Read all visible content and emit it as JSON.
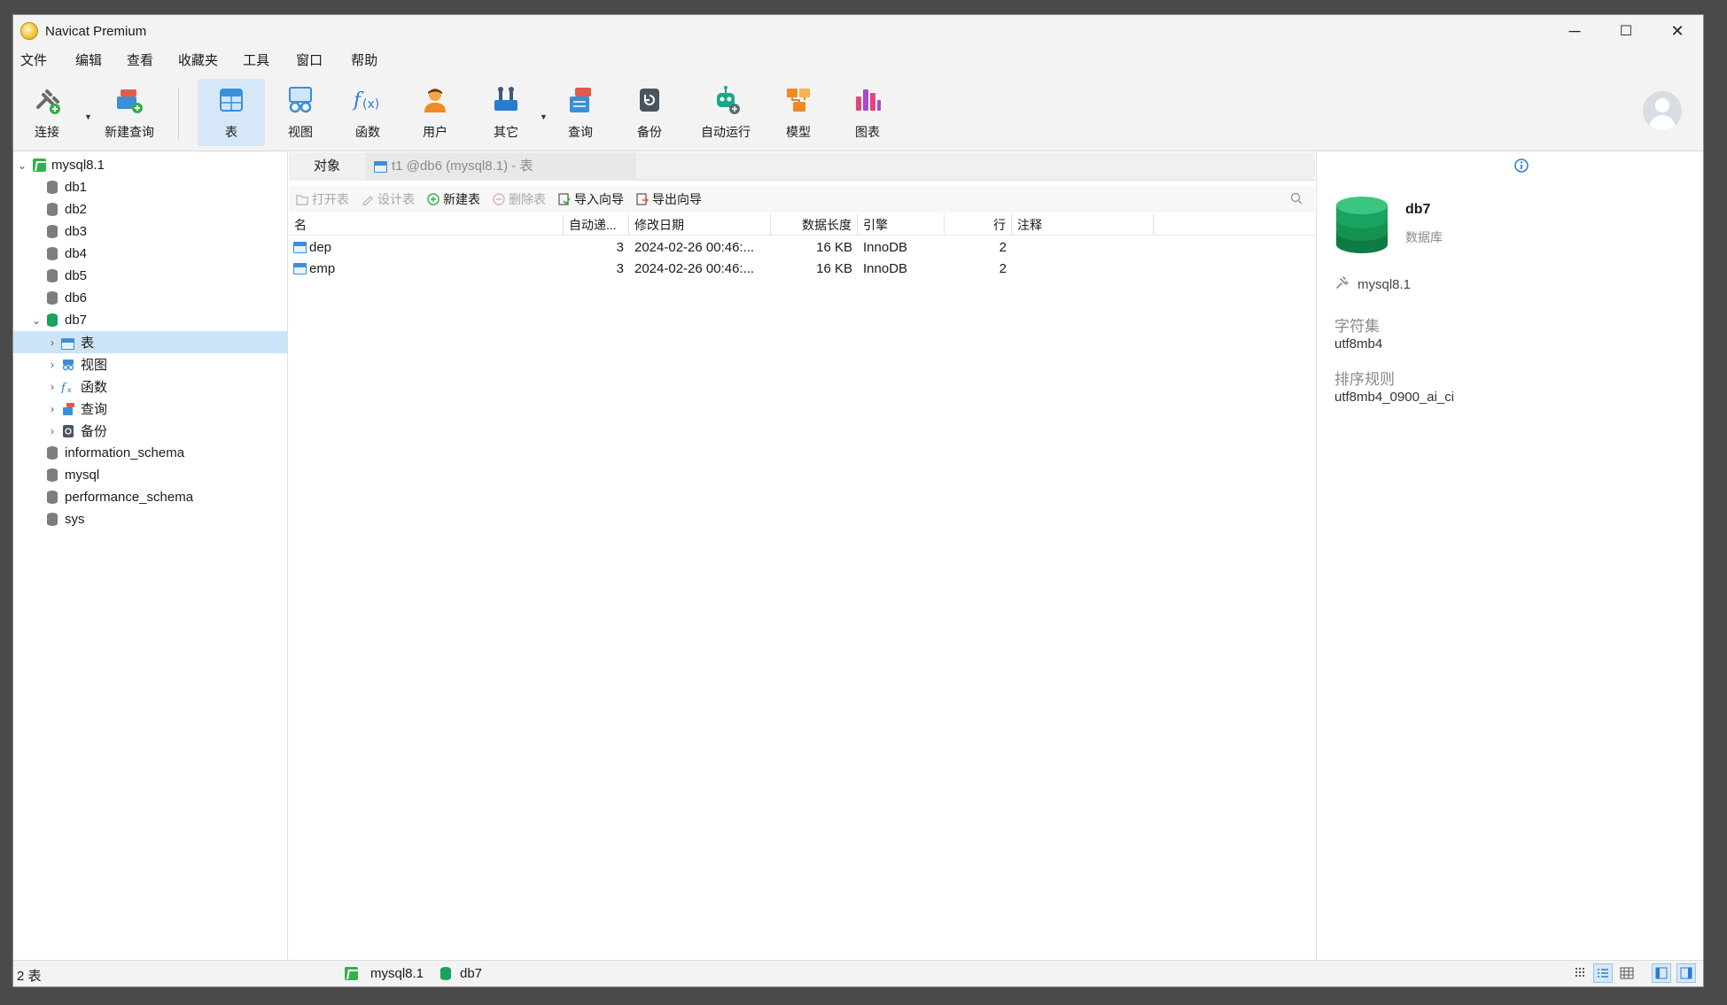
{
  "window": {
    "title": "Navicat Premium",
    "controls": {
      "minimize": "─",
      "maximize": "☐",
      "close": "✕"
    }
  },
  "menu": [
    "文件",
    "编辑",
    "查看",
    "收藏夹",
    "工具",
    "窗口",
    "帮助"
  ],
  "toolbar": {
    "connect": "连接",
    "new_query": "新建查询",
    "table": "表",
    "view": "视图",
    "function": "函数",
    "user": "用户",
    "other": "其它",
    "query": "查询",
    "backup": "备份",
    "automation": "自动运行",
    "model": "模型",
    "chart": "图表"
  },
  "tree": {
    "server": "mysql8.1",
    "databases": [
      "db1",
      "db2",
      "db3",
      "db4",
      "db5",
      "db6"
    ],
    "open_db": "db7",
    "open_db_children": [
      "表",
      "视图",
      "函数",
      "查询",
      "备份"
    ],
    "other_dbs": [
      "information_schema",
      "mysql",
      "performance_schema",
      "sys"
    ]
  },
  "tabs": {
    "objects": "对象",
    "query_tab": "t1 @db6 (mysql8.1) - 表"
  },
  "actions": {
    "open_table": "打开表",
    "design_table": "设计表",
    "new_table": "新建表",
    "delete_table": "删除表",
    "import_wizard": "导入向导",
    "export_wizard": "导出向导"
  },
  "table": {
    "columns": [
      "名",
      "自动递...",
      "修改日期",
      "数据长度",
      "引擎",
      "行",
      "注释"
    ],
    "rows": [
      {
        "name": "dep",
        "auto_inc": "3",
        "modified": "2024-02-26 00:46:...",
        "data_length": "16 KB",
        "engine": "InnoDB",
        "rows": "2",
        "comment": ""
      },
      {
        "name": "emp",
        "auto_inc": "3",
        "modified": "2024-02-26 00:46:...",
        "data_length": "16 KB",
        "engine": "InnoDB",
        "rows": "2",
        "comment": ""
      }
    ]
  },
  "info_panel": {
    "db_name": "db7",
    "db_type": "数据库",
    "connection": "mysql8.1",
    "charset_label": "字符集",
    "charset_value": "utf8mb4",
    "collation_label": "排序规则",
    "collation_value": "utf8mb4_0900_ai_ci"
  },
  "status": {
    "count": "2 表",
    "connection": "mysql8.1",
    "database": "db7"
  },
  "colors": {
    "accent_selected": "#cce4f7",
    "db_green": "#1aa260",
    "toolbar_active": "#d6e8f7"
  }
}
